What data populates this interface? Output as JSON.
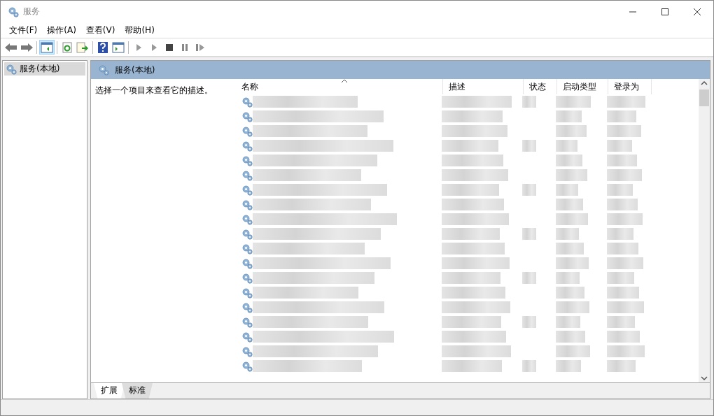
{
  "window": {
    "title": "服务",
    "controls": [
      {
        "kind": "minimize"
      },
      {
        "kind": "maximize"
      },
      {
        "kind": "close"
      }
    ]
  },
  "menu": [
    "文件(F)",
    "操作(A)",
    "查看(V)",
    "帮助(H)"
  ],
  "toolbar": [
    {
      "kind": "back",
      "selected": false
    },
    {
      "kind": "forward",
      "selected": false
    },
    {
      "kind": "sep"
    },
    {
      "kind": "tree",
      "selected": true
    },
    {
      "kind": "sep"
    },
    {
      "kind": "refresh",
      "selected": false
    },
    {
      "kind": "export",
      "selected": false
    },
    {
      "kind": "sep"
    },
    {
      "kind": "help",
      "selected": false
    },
    {
      "kind": "props",
      "selected": false
    },
    {
      "kind": "sep"
    },
    {
      "kind": "start",
      "selected": false
    },
    {
      "kind": "start",
      "selected": false
    },
    {
      "kind": "stop",
      "selected": false
    },
    {
      "kind": "pause",
      "selected": false
    },
    {
      "kind": "resume",
      "selected": false
    }
  ],
  "sidebar": {
    "items": [
      {
        "label": "服务(本地)",
        "selected": true
      }
    ]
  },
  "pane": {
    "title": "服务(本地)",
    "description": "选择一个项目来查看它的描述。"
  },
  "table": {
    "columns": [
      "名称",
      "描述",
      "状态",
      "启动类型",
      "登录为"
    ],
    "rows": [
      {
        "redacted": true
      },
      {
        "redacted": true
      },
      {
        "redacted": true
      },
      {
        "redacted": true
      },
      {
        "redacted": true
      },
      {
        "redacted": true
      },
      {
        "redacted": true
      },
      {
        "redacted": true
      },
      {
        "redacted": true
      },
      {
        "redacted": true
      },
      {
        "redacted": true
      },
      {
        "redacted": true
      },
      {
        "redacted": true
      },
      {
        "redacted": true
      },
      {
        "redacted": true
      },
      {
        "redacted": true
      },
      {
        "redacted": true
      },
      {
        "redacted": true
      },
      {
        "redacted": true
      }
    ]
  },
  "tabs": [
    {
      "label": "扩展",
      "selected": true
    },
    {
      "label": "标准",
      "selected": false
    }
  ]
}
